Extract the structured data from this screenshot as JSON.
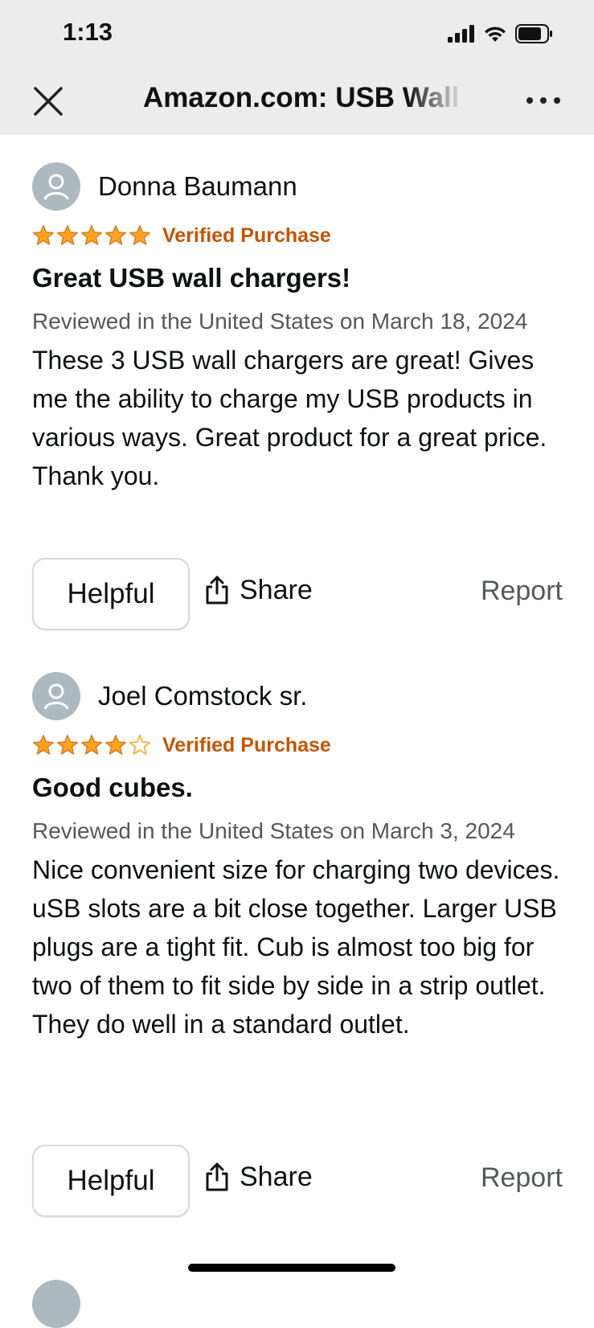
{
  "status_bar": {
    "time": "1:13"
  },
  "nav": {
    "title": "Amazon.com: USB Wall"
  },
  "colors": {
    "star": "#ffa41c",
    "verified": "#c45500",
    "report": "#565959"
  },
  "reviews": [
    {
      "reviewer": "Donna Baumann",
      "rating": 5,
      "verified": "Verified Purchase",
      "title": "Great USB wall chargers!",
      "date": "Reviewed in the United States on March 18, 2024",
      "body": "These 3 USB wall chargers are great! Gives me the ability to charge my USB products in various ways. Great product for a great price. Thank you.",
      "helpful_label": "Helpful",
      "share_label": "Share",
      "report_label": "Report"
    },
    {
      "reviewer": "Joel Comstock sr.",
      "rating": 4,
      "verified": "Verified Purchase",
      "title": "Good cubes.",
      "date": "Reviewed in the United States on March 3, 2024",
      "body": "Nice convenient size for charging two devices. uSB slots are a bit close together. Larger USB plugs are a tight fit. Cub is almost too big for two of them to fit side by side in a strip outlet. They do well in a standard outlet.",
      "helpful_label": "Helpful",
      "share_label": "Share",
      "report_label": "Report"
    }
  ]
}
